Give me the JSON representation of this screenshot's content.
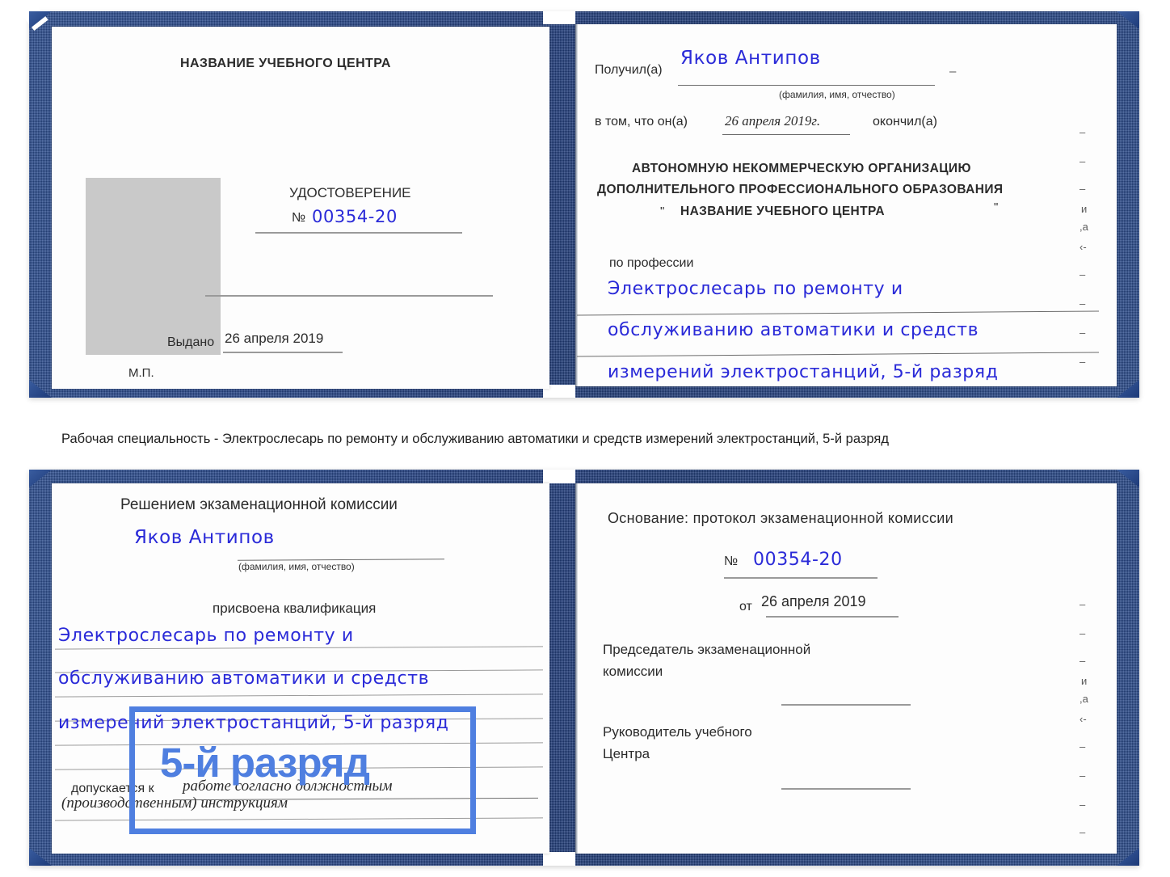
{
  "document": {
    "type": "certificate-scan",
    "caption": "Рабочая специальность - Электрослесарь по ремонту и обслуживанию автоматики и средств измерений электростанций, 5-й разряд",
    "highlight": {
      "text": "5-й разряд",
      "color": "#4f7fe0"
    },
    "colors": {
      "cover_blue": "#27468a",
      "ink_blue": "#2a2ad8",
      "highlight_blue": "#4f7fe0",
      "photo_gray": "#c9c9c9",
      "page_white": "#fdfdfd"
    }
  },
  "cert_top": {
    "left_page": {
      "heading": "НАЗВАНИЕ УЧЕБНОГО ЦЕНТРА",
      "doc_title": "УДОСТОВЕРЕНИЕ",
      "number_symbol": "№",
      "number_value": "00354-20",
      "issued_label": "Выдано",
      "issued_value": "26 апреля 2019",
      "seal_label": "М.П.",
      "photo_placeholder": "photo-placeholder"
    },
    "right_page": {
      "received_label": "Получил(а)",
      "received_value": "Яков Антипов",
      "fio_hint": "(фамилия, имя, отчество)",
      "that_label": "в том, что он(а)",
      "that_date": "26 апреля 2019г.",
      "finished_label": "окончил(а)",
      "org_line1": "АВТОНОМНУЮ НЕКОММЕРЧЕСКУЮ ОРГАНИЗАЦИЮ",
      "org_line2": "ДОПОЛНИТЕЛЬНОГО ПРОФЕССИОНАЛЬНОГО ОБРАЗОВАНИЯ",
      "org_quote_open": "\"",
      "org_line3": "НАЗВАНИЕ УЧЕБНОГО ЦЕНТРА",
      "org_quote_close": "\"",
      "profession_label": "по профессии",
      "profession_line1": "Электрослесарь по ремонту и",
      "profession_line2": "обслуживанию автоматики и средств",
      "profession_line3": "измерений электростанций, 5-й разряд",
      "margin_marks": [
        "–",
        "–",
        "–",
        "и",
        ",а",
        "‹-",
        "–",
        "–",
        "–",
        "–"
      ]
    }
  },
  "cert_bottom": {
    "left_page": {
      "heading": "Решением экзаменационной комиссии",
      "name_value": "Яков Антипов",
      "fio_hint": "(фамилия, имя, отчество)",
      "qualification_label": "присвоена квалификация",
      "qual_line1": "Электрослесарь по ремонту и",
      "qual_line2": "обслуживанию автоматики и средств",
      "qual_line3": "измерений электростанций, 5-й разряд",
      "admitted_label": "допускается к",
      "admitted_line1": "работе согласно должностным",
      "admitted_line2": "(производственным) инструкциям"
    },
    "right_page": {
      "basis_label": "Основание: протокол экзаменационной комиссии",
      "number_symbol": "№",
      "number_value": "00354-20",
      "from_label": "от",
      "from_value": "26 апреля 2019",
      "chairman_line1": "Председатель экзаменационной",
      "chairman_line2": "комиссии",
      "head_line1": "Руководитель учебного",
      "head_line2": "Центра",
      "margin_marks": [
        "–",
        "–",
        "–",
        "и",
        ",а",
        "‹-",
        "–",
        "–",
        "–",
        "–"
      ]
    }
  }
}
